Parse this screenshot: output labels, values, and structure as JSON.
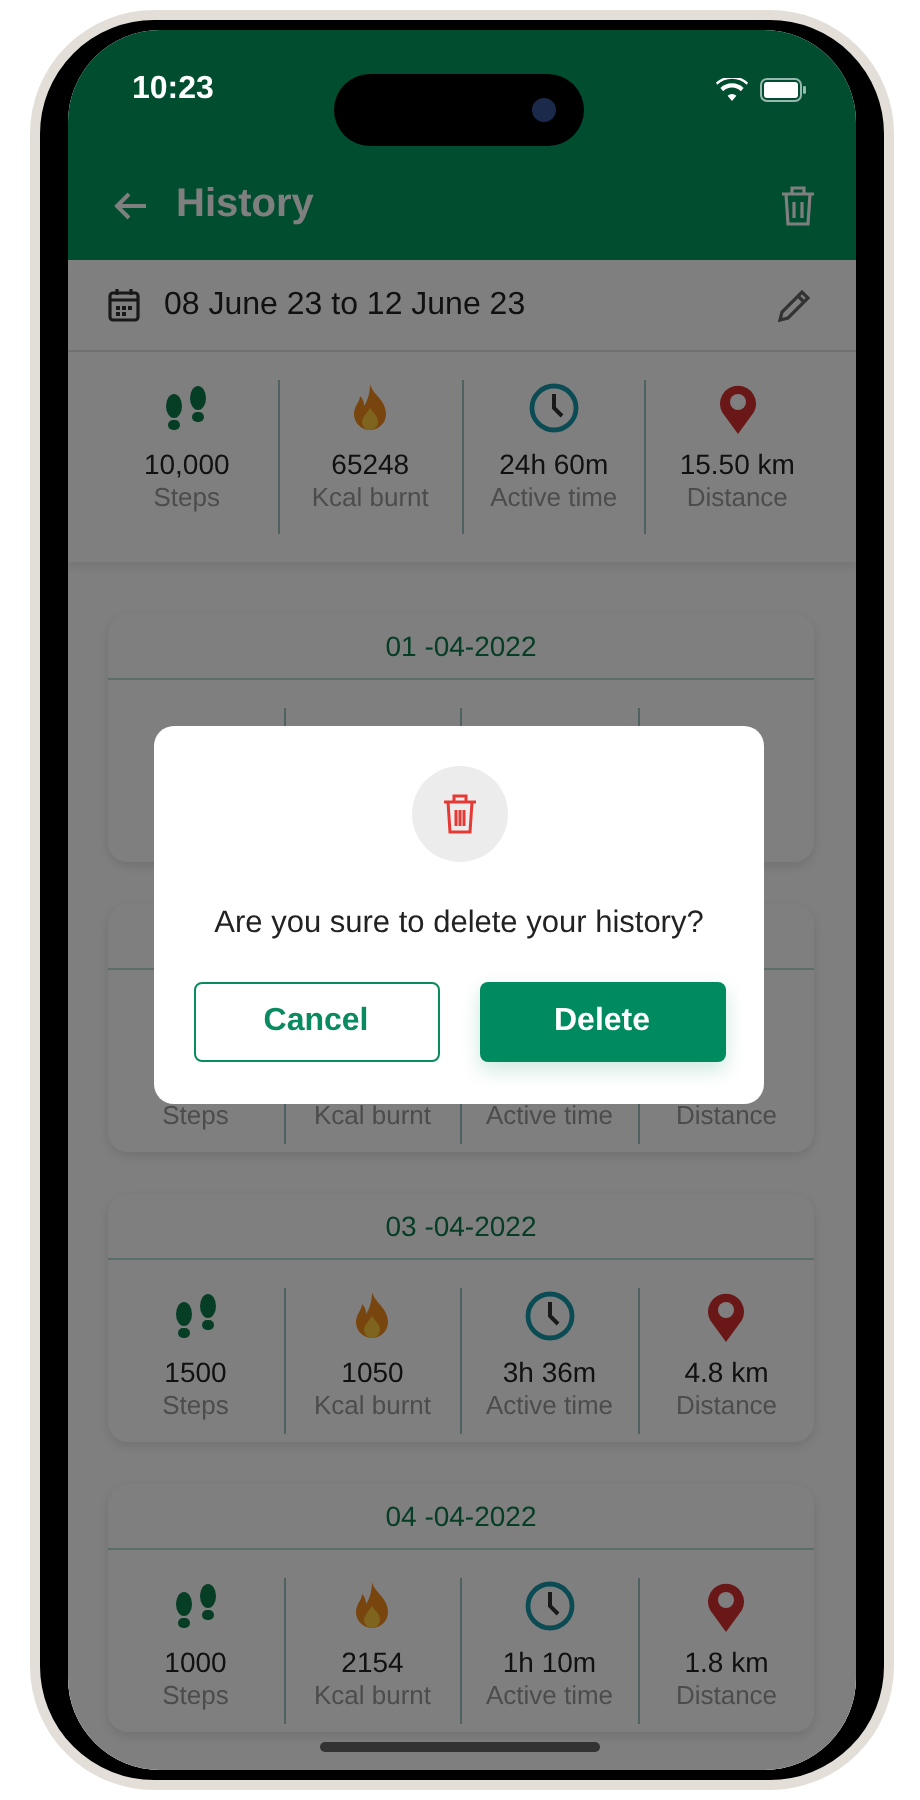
{
  "status_bar": {
    "time": "10:23"
  },
  "header": {
    "title": "History"
  },
  "date_range": {
    "text": "08 June 23 to 12 June 23"
  },
  "summary": [
    {
      "kind": "steps",
      "value": "10,000",
      "label": "Steps"
    },
    {
      "kind": "fire",
      "value": "65248",
      "label": "Kcal burnt"
    },
    {
      "kind": "clock",
      "value": "24h 60m",
      "label": "Active time"
    },
    {
      "kind": "pin",
      "value": "15.50 km",
      "label": "Distance"
    }
  ],
  "days": [
    {
      "date": "01 -04-2022"
    },
    {
      "stats": [
        {
          "label": "Steps"
        },
        {
          "label": "Kcal burnt"
        },
        {
          "label": "Active time"
        },
        {
          "label": "Distance"
        }
      ]
    },
    {
      "date": "03 -04-2022",
      "stats": [
        {
          "kind": "steps",
          "value": "1500",
          "label": "Steps"
        },
        {
          "kind": "fire",
          "value": "1050",
          "label": "Kcal burnt"
        },
        {
          "kind": "clock",
          "value": "3h 36m",
          "label": "Active time"
        },
        {
          "kind": "pin",
          "value": "4.8 km",
          "label": "Distance"
        }
      ]
    },
    {
      "date": "04 -04-2022",
      "stats": [
        {
          "kind": "steps",
          "value": "1000",
          "label": "Steps"
        },
        {
          "kind": "fire",
          "value": "2154",
          "label": "Kcal burnt"
        },
        {
          "kind": "clock",
          "value": "1h 10m",
          "label": "Active time"
        },
        {
          "kind": "pin",
          "value": "1.8 km",
          "label": "Distance"
        }
      ]
    }
  ],
  "dialog": {
    "message": "Are you sure to delete your history?",
    "buttons": [
      {
        "kind": "secondary",
        "label": "Cancel"
      },
      {
        "kind": "primary",
        "label": "Delete"
      }
    ]
  }
}
